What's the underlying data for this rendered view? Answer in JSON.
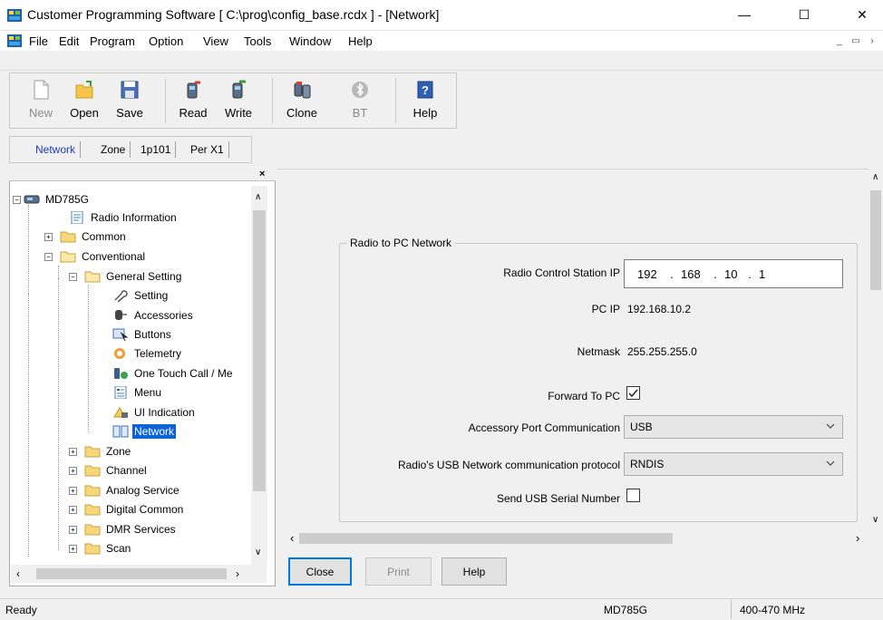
{
  "window": {
    "title": "Customer Programming Software [ C:\\prog\\config_base.rcdx ] - [Network]",
    "minimize": "—",
    "maximize": "☐",
    "close": "✕"
  },
  "menu": {
    "items": [
      "File",
      "Edit",
      "Program",
      "Option",
      "View",
      "Tools",
      "Window",
      "Help"
    ]
  },
  "toolbar": {
    "new": "New",
    "open": "Open",
    "save": "Save",
    "read": "Read",
    "write": "Write",
    "clone": "Clone",
    "bt": "BT",
    "help": "Help"
  },
  "tabs": [
    "Network",
    "Zone",
    "1p101",
    "Per X1"
  ],
  "tree": {
    "root": "MD785G",
    "items": [
      "Radio Information",
      "Common",
      "Conventional",
      "General Setting",
      "Setting",
      "Accessories",
      "Buttons",
      "Telemetry",
      "One Touch Call / Me",
      "Menu",
      "UI Indication",
      "Network",
      "Zone",
      "Channel",
      "Analog Service",
      "Digital Common",
      "DMR Services",
      "Scan"
    ]
  },
  "form": {
    "group_title": "Radio to PC Network",
    "radio_ip_label": "Radio Control Station IP",
    "radio_ip": [
      "192",
      ".",
      "168",
      ".",
      "10",
      ".",
      "1"
    ],
    "pc_ip_label": "PC IP",
    "pc_ip": "192.168.10.2",
    "netmask_label": "Netmask",
    "netmask": "255.255.255.0",
    "forward_label": "Forward To PC",
    "forward_checked": true,
    "accessory_label": "Accessory Port Communication",
    "accessory_value": "USB",
    "protocol_label": "Radio's USB Network communication protocol",
    "protocol_value": "RNDIS",
    "serial_label": "Send USB Serial Number",
    "serial_checked": false
  },
  "buttons": {
    "close": "Close",
    "print": "Print",
    "help": "Help"
  },
  "status": {
    "ready": "Ready",
    "model": "MD785G",
    "band": "400-470 MHz"
  }
}
